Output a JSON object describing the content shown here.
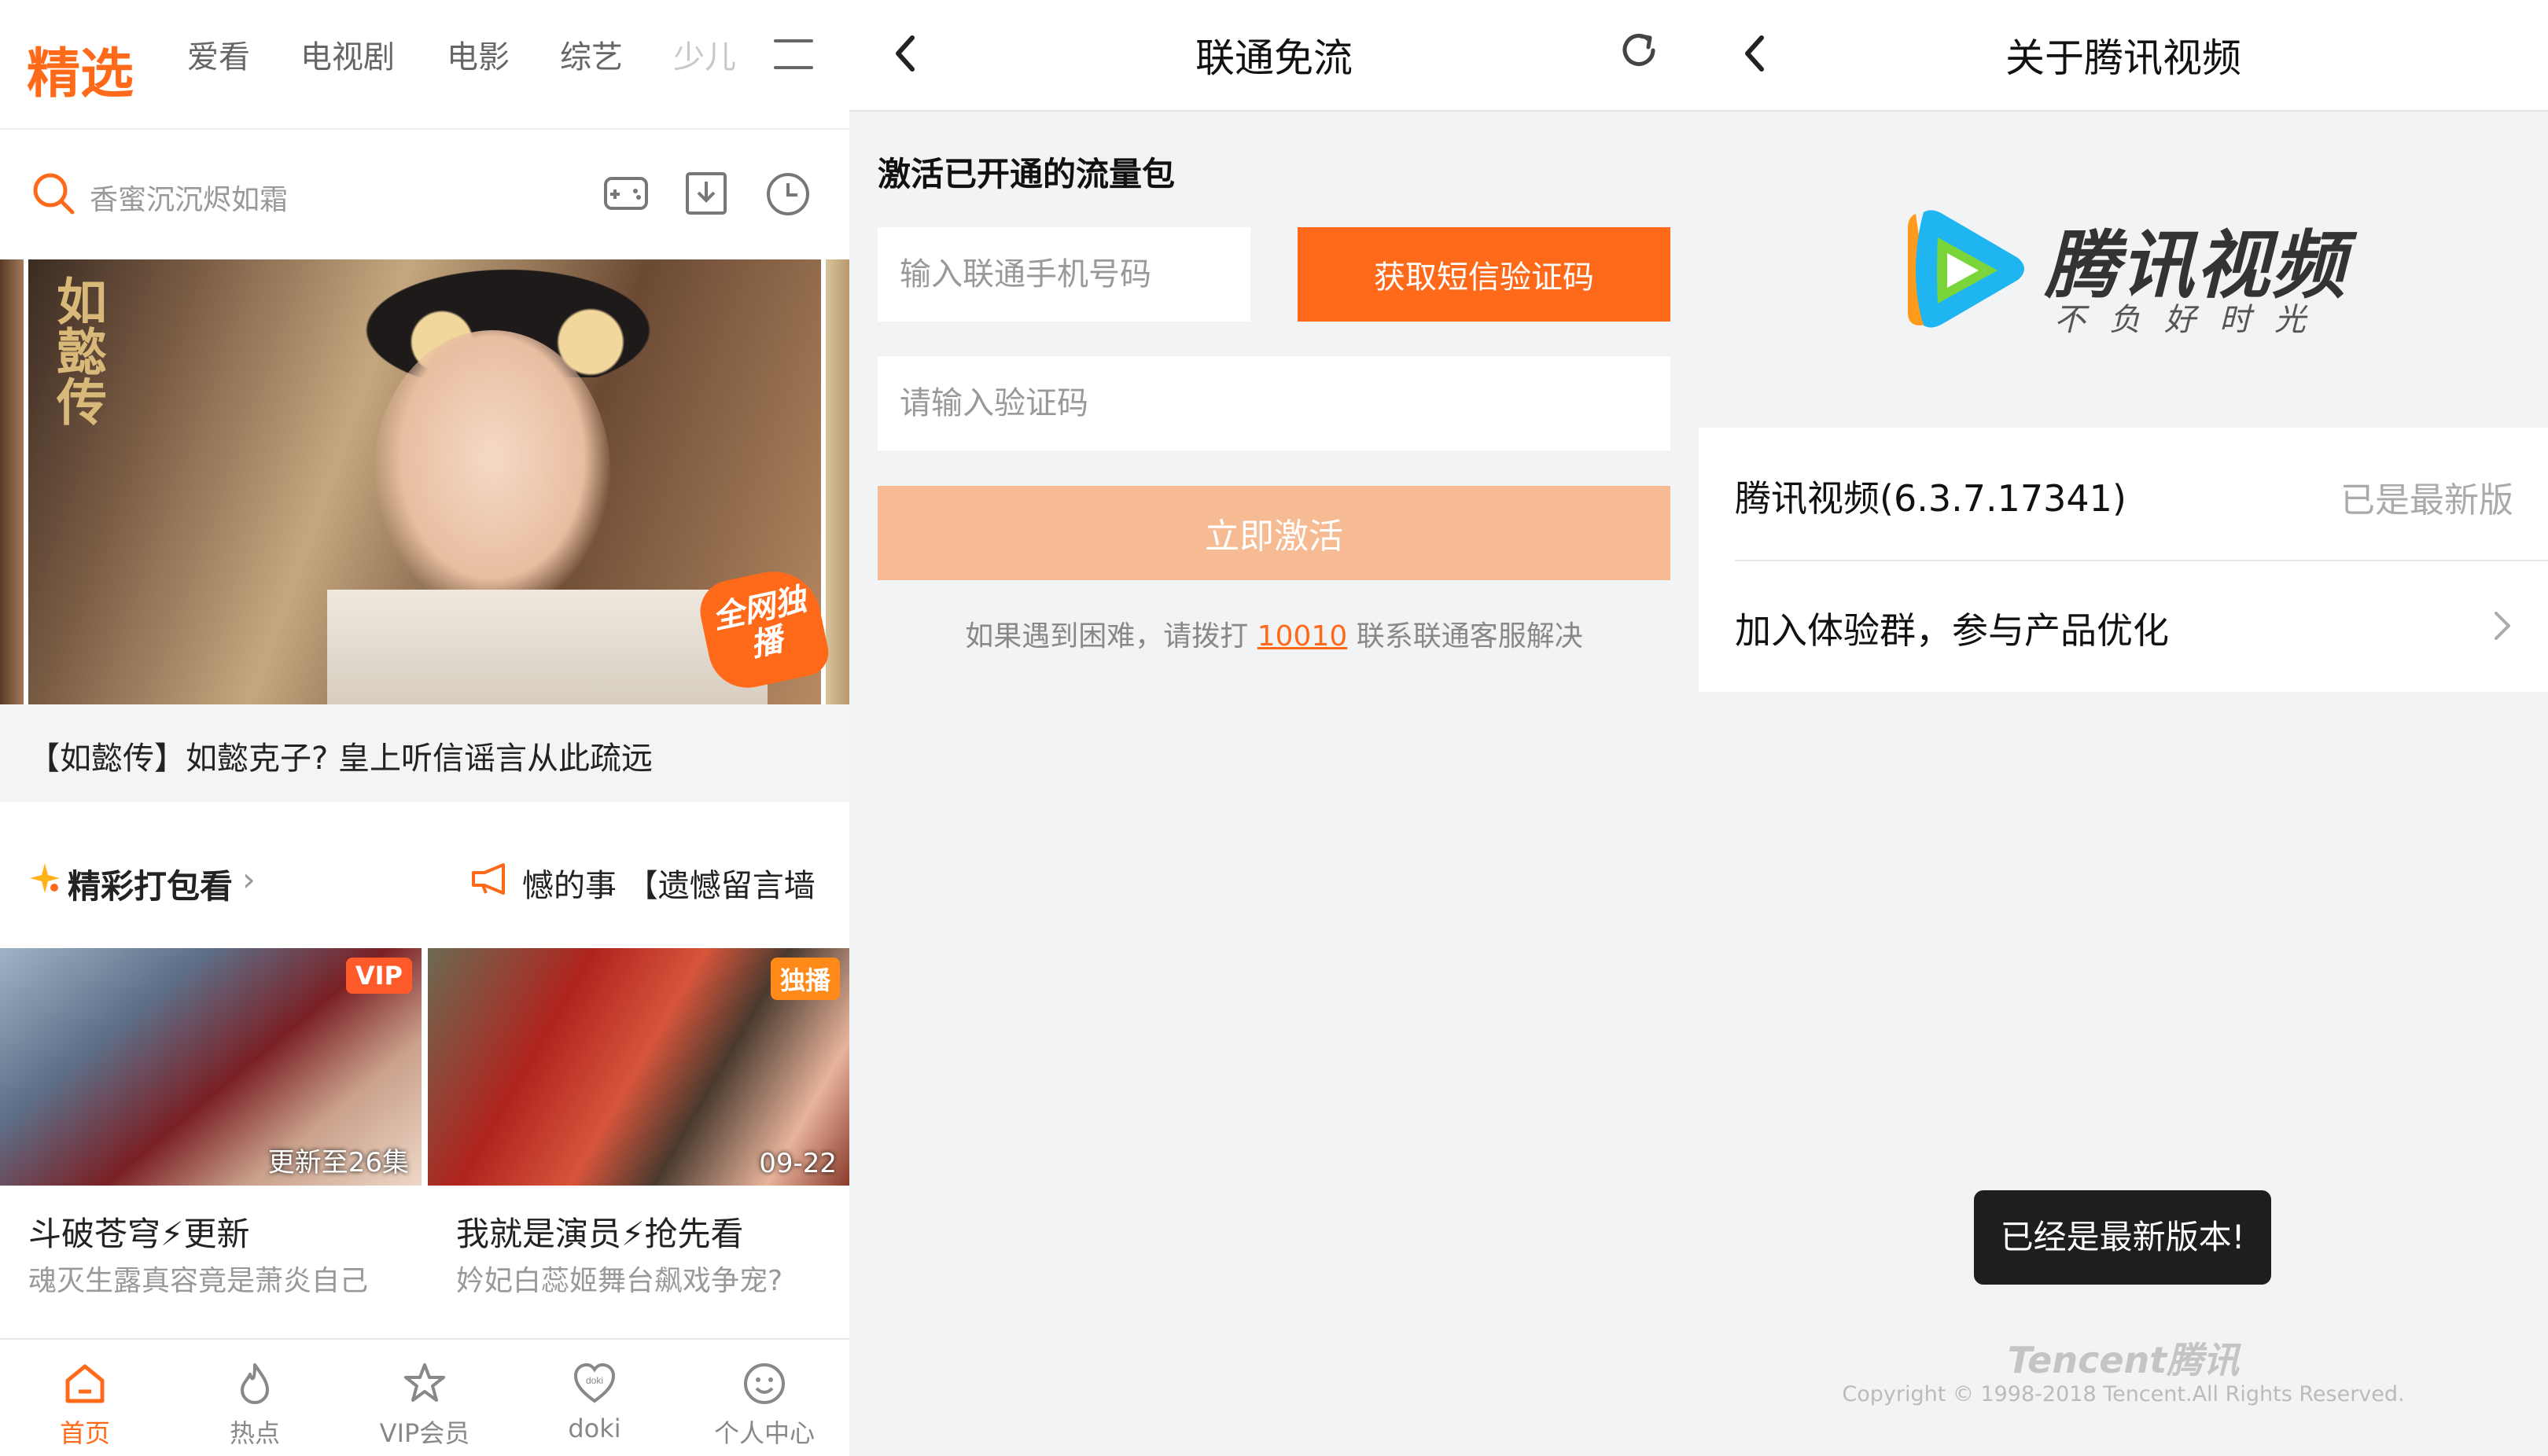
{
  "screen1": {
    "channels": [
      "精选",
      "爱看",
      "电视剧",
      "电影",
      "综艺",
      "少儿"
    ],
    "search": {
      "placeholder": "香蜜沉沉烬如霜"
    },
    "hero": {
      "poster_text": "如懿传",
      "badge": "全网独播",
      "caption": "【如懿传】如懿克子? 皇上听信谣言从此疏远"
    },
    "section": {
      "title": "精彩打包看",
      "arrow": "›",
      "ticker": "憾的事 【遗憾留言墙"
    },
    "cards": [
      {
        "badge": "VIP",
        "overlay": "更新至26集",
        "title": "斗破苍穹⚡更新",
        "subtitle": "魂灭生露真容竟是萧炎自己",
        "badge_color": "#ff5a2a"
      },
      {
        "badge": "独播",
        "overlay": "09-22",
        "title": "我就是演员⚡抢先看",
        "subtitle": "妗妃白蕊姬舞台飙戏争宠?",
        "badge_color": "#ff8a1a"
      }
    ],
    "tabs": [
      {
        "label": "首页",
        "icon": "home-icon",
        "active": true
      },
      {
        "label": "热点",
        "icon": "flame-icon",
        "active": false
      },
      {
        "label": "VIP会员",
        "icon": "vip-star-icon",
        "active": false
      },
      {
        "label": "doki",
        "icon": "doki-heart-icon",
        "active": false
      },
      {
        "label": "个人中心",
        "icon": "smile-icon",
        "active": false
      }
    ]
  },
  "screen2": {
    "title": "联通免流",
    "heading": "激活已开通的流量包",
    "phone_placeholder": "输入联通手机号码",
    "sms_button": "获取短信验证码",
    "code_placeholder": "请输入验证码",
    "activate_button": "立即激活",
    "help_prefix": "如果遇到困难，请拨打",
    "help_number": "10010",
    "help_suffix": "联系联通客服解决"
  },
  "screen3": {
    "title": "关于腾讯视频",
    "logo_name": "腾讯视频",
    "logo_slogan": "不负好时光",
    "version_label": "腾讯视频(6.3.7.17341)",
    "version_status": "已是最新版",
    "join_label": "加入体验群，参与产品优化",
    "toast": "已经是最新版本!",
    "brand": "Tencent腾讯",
    "copyright": "Copyright © 1998-2018 Tencent.All Rights Reserved."
  },
  "colors": {
    "accent": "#ff6a1a",
    "accent_disabled": "#f7bb93",
    "background": "#f2f3f5"
  }
}
